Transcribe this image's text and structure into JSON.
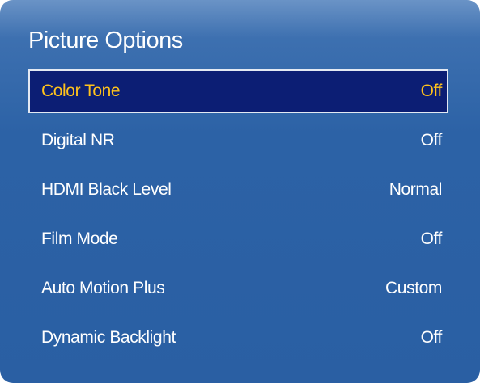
{
  "menu": {
    "title": "Picture Options",
    "items": [
      {
        "label": "Color Tone",
        "value": "Off",
        "selected": true
      },
      {
        "label": "Digital NR",
        "value": "Off",
        "selected": false
      },
      {
        "label": "HDMI Black Level",
        "value": "Normal",
        "selected": false
      },
      {
        "label": "Film Mode",
        "value": "Off",
        "selected": false
      },
      {
        "label": "Auto Motion Plus",
        "value": "Custom",
        "selected": false
      },
      {
        "label": "Dynamic Backlight",
        "value": "Off",
        "selected": false
      }
    ]
  },
  "colors": {
    "panel_background": "#2c62a6",
    "selected_background": "#0c1e74",
    "selected_text": "#ffc21c",
    "text": "#ffffff"
  }
}
